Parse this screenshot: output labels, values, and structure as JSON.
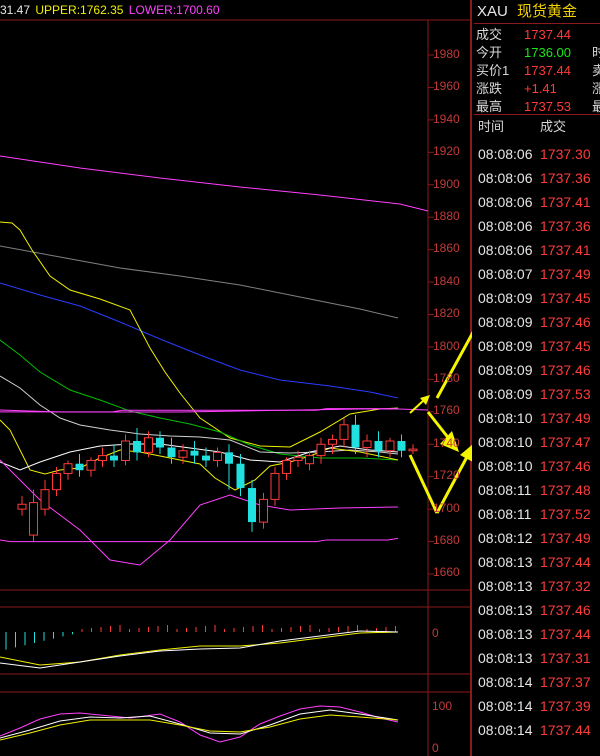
{
  "colors": {
    "up": "#ff3a3a",
    "down": "#20e0e0",
    "grid": "#8b1a1a",
    "upper_band": "#ff40ff",
    "mid_band": "#f0f000",
    "lower_band": "#ff40ff",
    "ma_blue": "#2a3cff",
    "ma_gray": "#808080",
    "ma_green": "#00c000",
    "ma_white": "#ffffff",
    "arrow": "#f5f500",
    "header_name": "#f0d000"
  },
  "indicator_bar": {
    "partial_text": "31.47",
    "upper_label": "UPPER:1762.35",
    "lower_label": "LOWER:1700.60"
  },
  "price_axis": {
    "ticks": [
      "1980",
      "1960",
      "1940",
      "1920",
      "1900",
      "1880",
      "1860",
      "1840",
      "1820",
      "1800",
      "1780",
      "1760",
      "1740",
      "1720",
      "1700",
      "1680",
      "1660"
    ]
  },
  "macd_panel": {
    "zero_label": "0"
  },
  "kdj_panel": {
    "labels": [
      "100",
      "0"
    ]
  },
  "chart_data": {
    "type": "candlestick",
    "y_range": [
      1655,
      1985
    ],
    "upper_band": [
      1760,
      1760,
      1760,
      1760,
      1760,
      1760,
      1760,
      1760,
      1760,
      1760,
      1760,
      1760,
      1761,
      1761,
      1761,
      1761,
      1761,
      1761,
      1761,
      1761,
      1761,
      1761,
      1761,
      1761,
      1761,
      1761,
      1761,
      1761,
      1761,
      1761,
      1761,
      1761,
      1762,
      1762,
      1762,
      1762,
      1762,
      1762,
      1762,
      1762
    ],
    "lower_band": [
      1681,
      1680,
      1680,
      1680,
      1680,
      1680,
      1680,
      1680,
      1680,
      1680,
      1680,
      1680,
      1680,
      1680,
      1680,
      1680,
      1680,
      1680,
      1680,
      1680,
      1680,
      1680,
      1680,
      1680,
      1680,
      1680,
      1680,
      1680,
      1680,
      1680,
      1680,
      1680,
      1681,
      1681,
      1681,
      1681,
      1681,
      1681,
      1681,
      1682
    ],
    "candles": [
      {
        "o": 1700,
        "h": 1708,
        "c": 1703,
        "l": 1696
      },
      {
        "o": 1684,
        "h": 1712,
        "c": 1704,
        "l": 1680
      },
      {
        "o": 1700,
        "h": 1718,
        "c": 1712,
        "l": 1696
      },
      {
        "o": 1712,
        "h": 1726,
        "c": 1722,
        "l": 1708
      },
      {
        "o": 1722,
        "h": 1730,
        "c": 1728,
        "l": 1718
      },
      {
        "o": 1728,
        "h": 1734,
        "c": 1724,
        "l": 1720
      },
      {
        "o": 1724,
        "h": 1732,
        "c": 1730,
        "l": 1720
      },
      {
        "o": 1730,
        "h": 1738,
        "c": 1733,
        "l": 1726
      },
      {
        "o": 1733,
        "h": 1740,
        "c": 1730,
        "l": 1726
      },
      {
        "o": 1730,
        "h": 1746,
        "c": 1742,
        "l": 1727
      },
      {
        "o": 1742,
        "h": 1750,
        "c": 1735,
        "l": 1730
      },
      {
        "o": 1735,
        "h": 1748,
        "c": 1744,
        "l": 1732
      },
      {
        "o": 1744,
        "h": 1748,
        "c": 1738,
        "l": 1734
      },
      {
        "o": 1738,
        "h": 1744,
        "c": 1732,
        "l": 1728
      },
      {
        "o": 1732,
        "h": 1740,
        "c": 1736,
        "l": 1728
      },
      {
        "o": 1736,
        "h": 1742,
        "c": 1733,
        "l": 1728
      },
      {
        "o": 1733,
        "h": 1738,
        "c": 1730,
        "l": 1726
      },
      {
        "o": 1730,
        "h": 1738,
        "c": 1735,
        "l": 1726
      },
      {
        "o": 1735,
        "h": 1740,
        "c": 1728,
        "l": 1712
      },
      {
        "o": 1728,
        "h": 1734,
        "c": 1713,
        "l": 1708
      },
      {
        "o": 1713,
        "h": 1718,
        "c": 1692,
        "l": 1686
      },
      {
        "o": 1692,
        "h": 1710,
        "c": 1706,
        "l": 1688
      },
      {
        "o": 1706,
        "h": 1726,
        "c": 1722,
        "l": 1702
      },
      {
        "o": 1722,
        "h": 1732,
        "c": 1730,
        "l": 1718
      },
      {
        "o": 1730,
        "h": 1736,
        "c": 1732,
        "l": 1726
      },
      {
        "o": 1728,
        "h": 1736,
        "c": 1733,
        "l": 1724
      },
      {
        "o": 1733,
        "h": 1744,
        "c": 1740,
        "l": 1728
      },
      {
        "o": 1740,
        "h": 1746,
        "c": 1743,
        "l": 1734
      },
      {
        "o": 1743,
        "h": 1756,
        "c": 1752,
        "l": 1738
      },
      {
        "o": 1752,
        "h": 1758,
        "c": 1738,
        "l": 1734
      },
      {
        "o": 1738,
        "h": 1746,
        "c": 1742,
        "l": 1732
      },
      {
        "o": 1742,
        "h": 1748,
        "c": 1736,
        "l": 1732
      },
      {
        "o": 1736,
        "h": 1744,
        "c": 1742,
        "l": 1732
      },
      {
        "o": 1742,
        "h": 1746,
        "c": 1736,
        "l": 1732
      },
      {
        "o": 1736,
        "h": 1740,
        "c": 1737,
        "l": 1734
      }
    ]
  },
  "header": {
    "code": "XAU",
    "name": "现货黄金"
  },
  "quote": [
    {
      "label": "成交",
      "value": "1737.44",
      "color": "#ff3a3a",
      "extra": ""
    },
    {
      "label": "今开",
      "value": "1736.00",
      "color": "#19e619",
      "extra": "时"
    },
    {
      "label": "买价1",
      "value": "1737.44",
      "color": "#ff3a3a",
      "extra": "卖"
    },
    {
      "label": "涨跌",
      "value": "+1.41",
      "color": "#ff3a3a",
      "extra": "涨"
    },
    {
      "label": "最高",
      "value": "1737.53",
      "color": "#ff3a3a",
      "extra": "最"
    }
  ],
  "ticks_header": {
    "time": "时间",
    "price": "成交"
  },
  "ticks": [
    {
      "time": "08:08:06",
      "price": "1737.30"
    },
    {
      "time": "08:08:06",
      "price": "1737.36"
    },
    {
      "time": "08:08:06",
      "price": "1737.41"
    },
    {
      "time": "08:08:06",
      "price": "1737.36"
    },
    {
      "time": "08:08:06",
      "price": "1737.41"
    },
    {
      "time": "08:08:07",
      "price": "1737.49"
    },
    {
      "time": "08:08:09",
      "price": "1737.45"
    },
    {
      "time": "08:08:09",
      "price": "1737.46"
    },
    {
      "time": "08:08:09",
      "price": "1737.45"
    },
    {
      "time": "08:08:09",
      "price": "1737.46"
    },
    {
      "time": "08:08:09",
      "price": "1737.53"
    },
    {
      "time": "08:08:10",
      "price": "1737.49"
    },
    {
      "time": "08:08:10",
      "price": "1737.47"
    },
    {
      "time": "08:08:10",
      "price": "1737.46"
    },
    {
      "time": "08:08:11",
      "price": "1737.48"
    },
    {
      "time": "08:08:11",
      "price": "1737.52"
    },
    {
      "time": "08:08:12",
      "price": "1737.49"
    },
    {
      "time": "08:08:13",
      "price": "1737.44"
    },
    {
      "time": "08:08:13",
      "price": "1737.32"
    },
    {
      "time": "08:08:13",
      "price": "1737.46"
    },
    {
      "time": "08:08:13",
      "price": "1737.44"
    },
    {
      "time": "08:08:13",
      "price": "1737.31"
    },
    {
      "time": "08:08:14",
      "price": "1737.37"
    },
    {
      "time": "08:08:14",
      "price": "1737.39"
    },
    {
      "time": "08:08:14",
      "price": "1737.44"
    }
  ]
}
